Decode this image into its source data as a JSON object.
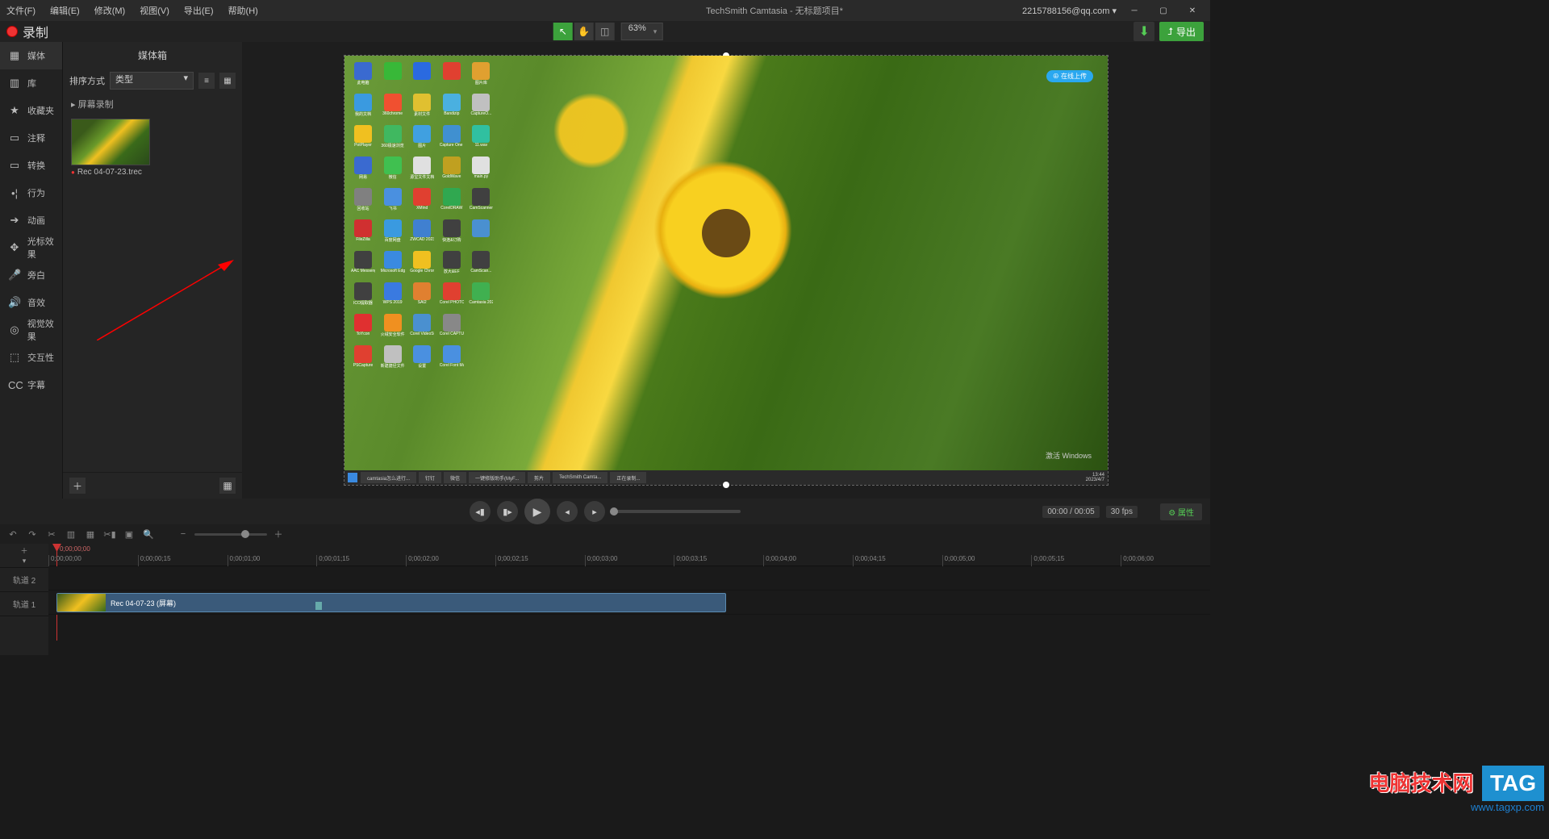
{
  "title": "TechSmith Camtasia - 无标题项目*",
  "account": "2215788156@qq.com ▾",
  "menu": [
    "文件(F)",
    "编辑(E)",
    "修改(M)",
    "视图(V)",
    "导出(E)",
    "帮助(H)"
  ],
  "record_label": "录制",
  "zoom": "63%",
  "export_label": "导出",
  "sidebar": [
    {
      "icon": "▦",
      "label": "媒体"
    },
    {
      "icon": "▥",
      "label": "库"
    },
    {
      "icon": "★",
      "label": "收藏夹"
    },
    {
      "icon": "▭",
      "label": "注释"
    },
    {
      "icon": "▭",
      "label": "转换"
    },
    {
      "icon": "•¦",
      "label": "行为"
    },
    {
      "icon": "➔",
      "label": "动画"
    },
    {
      "icon": "✥",
      "label": "光标效果"
    },
    {
      "icon": "🎤",
      "label": "旁白"
    },
    {
      "icon": "🔊",
      "label": "音效"
    },
    {
      "icon": "◎",
      "label": "视觉效果"
    },
    {
      "icon": "⬚",
      "label": "交互性"
    },
    {
      "icon": "CC",
      "label": "字幕"
    }
  ],
  "panel": {
    "title": "媒体箱",
    "sort_label": "排序方式",
    "sort_value": "类型",
    "section": "屏幕录制",
    "media_item": "Rec 04-07-23.trec"
  },
  "playback": {
    "time": "00:00 / 00:05",
    "fps": "30 fps"
  },
  "properties_label": "属性",
  "timeline": {
    "playhead_time": "0;00;00;00",
    "marks": [
      "0;00;00;00",
      "0;00;00;15",
      "0;00;01;00",
      "0;00;01;15",
      "0;00;02;00",
      "0;00;02;15",
      "0;00;03;00",
      "0;00;03;15",
      "0;00;04;00",
      "0;00;04;15",
      "0;00;05;00",
      "0;00;05;15",
      "0;00;06;00"
    ],
    "track2": "轨道 2",
    "track1": "轨道 1",
    "clip_label": "Rec 04-07-23 (屏幕)"
  },
  "canvas": {
    "cloud_badge": "⊕ 在线上传",
    "taskbar_items": [
      "camtasia怎么进行...",
      "钉钉",
      "微信",
      "一键修版助手(MyF...",
      "剪片",
      "TechSmith Camta...",
      "正在录制..."
    ],
    "taskbar_time": "13:44",
    "taskbar_date": "2023/4/7",
    "activate_win": "激活 Windows",
    "desk_apps": [
      [
        "此电脑",
        "#3a6ad0"
      ],
      [
        "",
        "#38b838"
      ],
      [
        "",
        "#2a6ae0"
      ],
      [
        "",
        "#e04030"
      ],
      [
        "图片库",
        "#e0a030"
      ],
      [
        "我的文档",
        "#3a9ae0"
      ],
      [
        "360chrome",
        "#f05030"
      ],
      [
        "素材文件",
        "#e0c030"
      ],
      [
        "Bandizip",
        "#4ab0e0"
      ],
      [
        "CaptureO...",
        "#c0c0c0"
      ],
      [
        "PotPlayer",
        "#f0c020"
      ],
      [
        "360极速浏览",
        "#40b860"
      ],
      [
        "图片",
        "#40a0e0"
      ],
      [
        "Capture One 10",
        "#4090d0"
      ],
      [
        "11.wav",
        "#30c0a0"
      ],
      [
        "网易",
        "#3a6ad0"
      ],
      [
        "微信",
        "#40c050"
      ],
      [
        "源宝文件文档",
        "#e0e0e0"
      ],
      [
        "GoldWave",
        "#c0a020"
      ],
      [
        "main.py",
        "#e0e0e0"
      ],
      [
        "回收站",
        "#808080"
      ],
      [
        "飞书",
        "#4a90e0"
      ],
      [
        "XMind",
        "#e04030"
      ],
      [
        "CorelDRAW",
        "#30a850"
      ],
      [
        "CamScanner",
        "#404040"
      ],
      [
        "FileZilla",
        "#d03030"
      ],
      [
        "百度网盘",
        "#3a9ae0"
      ],
      [
        "ZWCAD 2023",
        "#4080d0"
      ],
      [
        "快连&订购",
        "#404040"
      ],
      [
        "",
        "#4a90d0"
      ],
      [
        "AAC Messenger",
        "#404040"
      ],
      [
        "Microsoft Edge",
        "#3a8ae0"
      ],
      [
        "Google Chrome",
        "#f0c020"
      ],
      [
        "放大&EF",
        "#404040"
      ],
      [
        "CamScan...",
        "#404040"
      ],
      [
        "ICO提取器",
        "#404040"
      ],
      [
        "WPS 2019",
        "#3a7ae0"
      ],
      [
        "SAI2",
        "#e08030"
      ],
      [
        "Corel PHOTO-P...",
        "#e04030"
      ],
      [
        "Camtasia 2020",
        "#40b050"
      ],
      [
        "ToYcon",
        "#e03030"
      ],
      [
        "火绒安全软件",
        "#f09020"
      ],
      [
        "Corel VideoStud...",
        "#4a90d0"
      ],
      [
        "Corel CAPTURE",
        "#888888"
      ],
      [
        "",
        ""
      ],
      [
        "PSCapture",
        "#e04030"
      ],
      [
        "新建捷径文件",
        "#c0c0c0"
      ],
      [
        "设置",
        "#4a90e0"
      ],
      [
        "Corel Font Manager",
        "#4a90e0"
      ],
      [
        "",
        ""
      ]
    ]
  },
  "watermark": {
    "main": "电脑技术网",
    "tag": "TAG",
    "url": "www.tagxp.com"
  }
}
